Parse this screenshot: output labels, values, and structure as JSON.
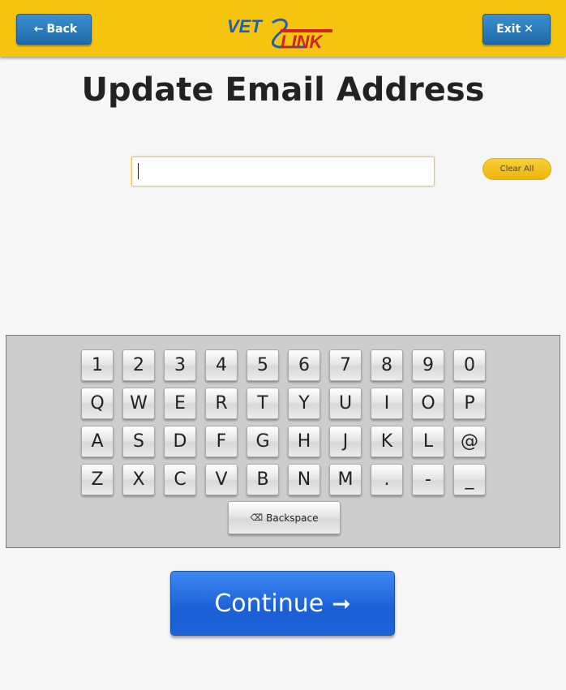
{
  "header": {
    "back_label": "Back",
    "back_icon": "←",
    "exit_label": "Exit",
    "exit_icon": "✕",
    "logo": {
      "word1": "VET",
      "word2": "LINK",
      "colors": {
        "vet": "#1b5fb8",
        "link": "#d32222",
        "swoosh": "#1b5fb8",
        "bar": "#f5c40f"
      }
    }
  },
  "page_title": "Update Email Address",
  "email": {
    "value": "",
    "placeholder": ""
  },
  "clear_all_label": "Clear All",
  "keyboard": {
    "rows": [
      [
        "1",
        "2",
        "3",
        "4",
        "5",
        "6",
        "7",
        "8",
        "9",
        "0"
      ],
      [
        "Q",
        "W",
        "E",
        "R",
        "T",
        "Y",
        "U",
        "I",
        "O",
        "P"
      ],
      [
        "A",
        "S",
        "D",
        "F",
        "G",
        "H",
        "J",
        "K",
        "L",
        "@"
      ],
      [
        "Z",
        "X",
        "C",
        "V",
        "B",
        "N",
        "M",
        ".",
        "-",
        "_"
      ]
    ],
    "backspace_icon": "⌫",
    "backspace_label": "Backspace"
  },
  "continue": {
    "label": "Continue",
    "icon": "➞"
  },
  "colors": {
    "accent_yellow": "#f5c40f",
    "primary_blue": "#1f6aa8",
    "continue_blue": "#1b5fd6"
  }
}
